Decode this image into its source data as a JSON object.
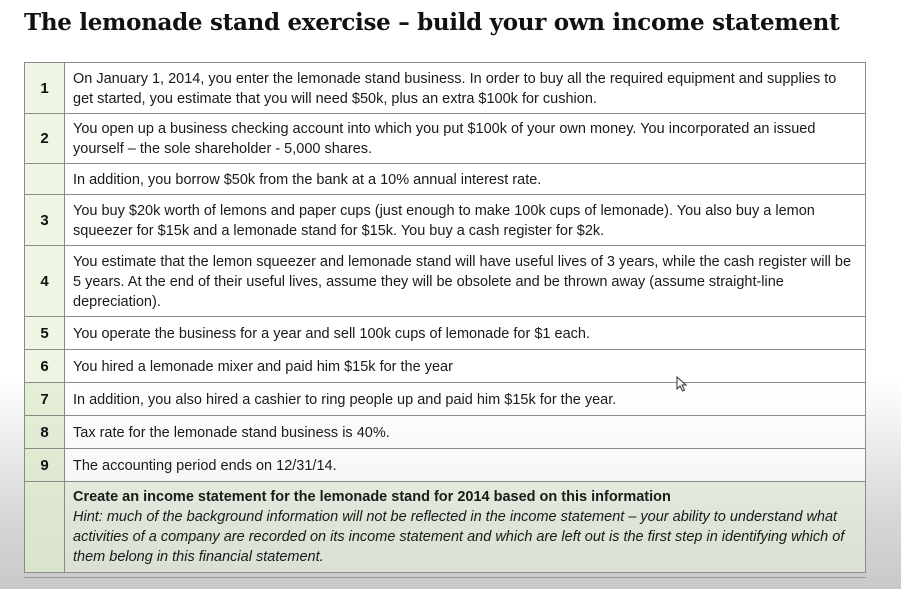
{
  "title": "The lemonade stand exercise – build your own income statement",
  "rows": [
    {
      "num": "1",
      "text": "On January 1, 2014, you enter the lemonade stand business. In order to buy all the required equipment and supplies to get started, you estimate that you will need $50k, plus an extra $100k for cushion."
    },
    {
      "num": "2",
      "text": "You open up a business checking account into which you put $100k of your own money. You incorporated an issued yourself – the sole shareholder - 5,000 shares."
    },
    {
      "num": "",
      "text": "In addition, you borrow $50k from the bank at a 10% annual interest rate."
    },
    {
      "num": "3",
      "text": "You buy $20k worth of lemons and paper cups (just enough to make 100k cups of lemonade). You also buy a lemon squeezer for $15k and a lemonade stand for $15k. You buy a cash register for $2k."
    },
    {
      "num": "4",
      "text": "You estimate that the lemon squeezer and lemonade stand will have useful lives of 3 years, while the cash register will be 5 years. At the end of their useful lives, assume they will be obsolete and be thrown away (assume straight-line depreciation)."
    },
    {
      "num": "5",
      "text": "You operate the business for a year and sell 100k cups of lemonade for $1 each."
    },
    {
      "num": "6",
      "text": "You hired a lemonade mixer and paid him $15k for the year"
    },
    {
      "num": "7",
      "text": "In addition, you also hired a cashier to ring people up and paid him $15k for the year."
    },
    {
      "num": "8",
      "text": "Tax rate for the lemonade stand business is 40%."
    },
    {
      "num": "9",
      "text": "The accounting period ends on 12/31/14."
    }
  ],
  "final": {
    "num": "",
    "heading": "Create an income statement for the lemonade stand for 2014 based on this information",
    "hint": "Hint: much of the background information will not be reflected in the income statement – your ability to understand what activities of a company are recorded on its income statement and which are left out is the first step in identifying which of them belong in this financial statement."
  },
  "cursor_icon": "mouse-pointer-icon",
  "colors": {
    "number_cell": "#eef5e3",
    "border": "#8a8a8a",
    "text": "#1a1a1a"
  }
}
